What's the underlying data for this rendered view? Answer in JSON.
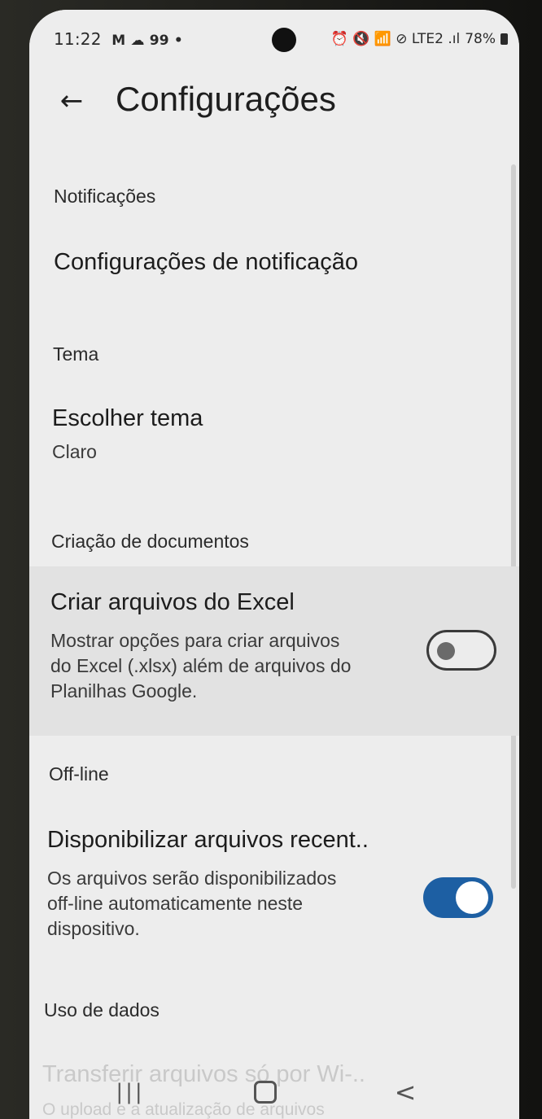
{
  "status_bar": {
    "time": "11:22",
    "left_icons": "M ☁ 99 •",
    "right_icons": "⏰ 🔇 📶 ⊘ LTE2 .ıl",
    "battery": "78%"
  },
  "appbar": {
    "back_icon": "←",
    "title": "Configurações"
  },
  "sections": {
    "notifications": {
      "header": "Notificações",
      "item_title": "Configurações de notificação"
    },
    "theme": {
      "header": "Tema",
      "item_title": "Escolher tema",
      "item_value": "Claro"
    },
    "doc_creation": {
      "header": "Criação de documentos",
      "item_title": "Criar arquivos do Excel",
      "item_desc_1": "Mostrar opções para criar arquivos",
      "item_desc_2": "do Excel (.xlsx) além de arquivos do",
      "item_desc_3": "Planilhas Google.",
      "toggle_on": false
    },
    "offline": {
      "header": "Off-line",
      "item_title": "Disponibilizar arquivos recent..",
      "item_desc_1": "Os arquivos serão disponibilizados",
      "item_desc_2": "off-line automaticamente neste",
      "item_desc_3": "dispositivo.",
      "toggle_on": true
    },
    "data_usage": {
      "header": "Uso de dados",
      "item_title_partial": "Transferir arquivos só por Wi-..",
      "item_desc_partial": "O upload e a atualização de arquivos"
    }
  },
  "navbar": {
    "recents_icon": "|||",
    "back_icon": "<"
  },
  "colors": {
    "toggle_on": "#1d5fa3",
    "background": "#ededed",
    "highlight_row": "#e2e2e2"
  }
}
